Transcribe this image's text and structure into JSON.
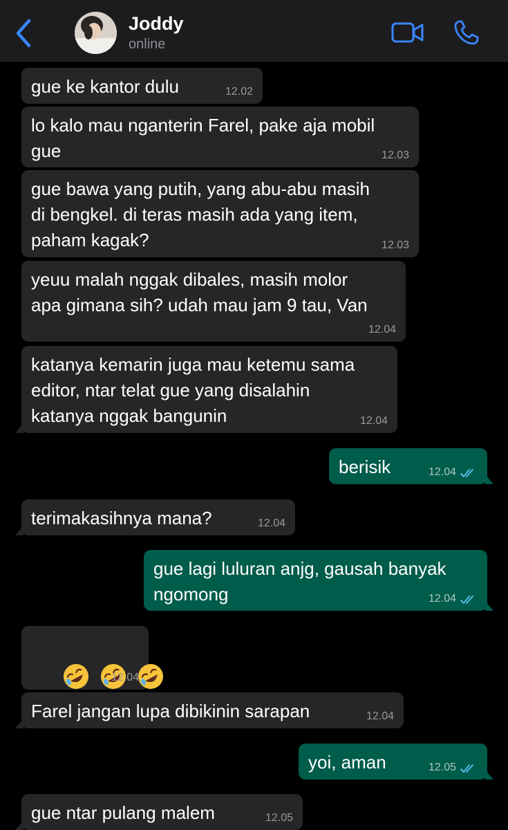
{
  "header": {
    "contact_name": "Joddy",
    "status": "online",
    "accent_color": "#3a86ff"
  },
  "messages": [
    {
      "direction": "in",
      "text": "gue ke kantor dulu",
      "time": "12.02"
    },
    {
      "direction": "in",
      "text": "lo kalo mau nganterin Farel, pake aja mobil\ngue",
      "time": "12.03"
    },
    {
      "direction": "in",
      "text": "gue bawa yang putih, yang abu-abu masih\ndi bengkel. di teras masih ada yang item,\npaham kagak?",
      "time": "12.03"
    },
    {
      "direction": "in",
      "text": "yeuu malah nggak dibales, masih molor\napa gimana sih? udah mau jam 9 tau, Van",
      "time": "12.04"
    },
    {
      "direction": "in",
      "text": "katanya kemarin juga mau ketemu sama\neditor, ntar telat gue yang disalahin\nkatanya nggak bangunin",
      "time": "12.04"
    },
    {
      "direction": "out",
      "text": "berisik",
      "time": "12.04",
      "status": "read"
    },
    {
      "direction": "in",
      "text": "terimakasihnya mana?",
      "time": "12.04"
    },
    {
      "direction": "out",
      "text": "gue lagi luluran anjg, gausah banyak\nngomong",
      "time": "12.04",
      "status": "read"
    },
    {
      "direction": "in",
      "emoji": [
        "rolling-on-floor-laughing",
        "rolling-on-floor-laughing",
        "rolling-on-floor-laughing"
      ],
      "time": "12.04"
    },
    {
      "direction": "in",
      "text": "Farel jangan lupa dibikinin sarapan",
      "time": "12.04"
    },
    {
      "direction": "out",
      "text": "yoi, aman",
      "time": "12.05",
      "status": "read"
    },
    {
      "direction": "in",
      "text": "gue ntar pulang malem",
      "time": "12.05"
    }
  ]
}
